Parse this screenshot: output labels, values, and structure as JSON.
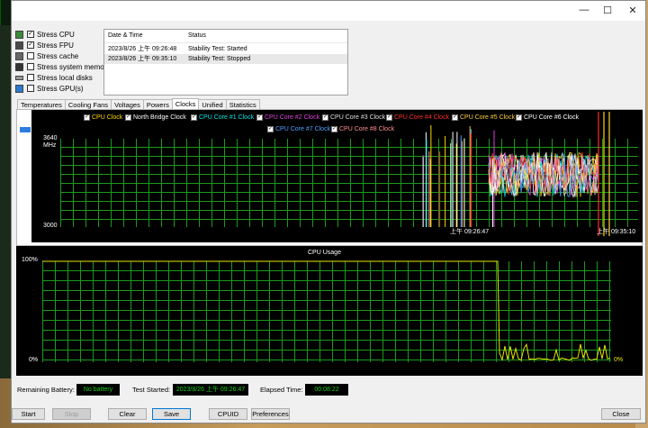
{
  "window": {
    "controls": {
      "minimize": "—",
      "maximize": "☐",
      "close": "✕"
    }
  },
  "stress_options": [
    {
      "label": "Stress CPU",
      "checked": true,
      "icon": "cpu-icon"
    },
    {
      "label": "Stress FPU",
      "checked": true,
      "icon": "fpu-icon"
    },
    {
      "label": "Stress cache",
      "checked": false,
      "icon": "cache-icon"
    },
    {
      "label": "Stress system memory",
      "checked": false,
      "icon": "memory-icon"
    },
    {
      "label": "Stress local disks",
      "checked": false,
      "icon": "disk-icon"
    },
    {
      "label": "Stress GPU(s)",
      "checked": false,
      "icon": "gpu-icon"
    }
  ],
  "log": {
    "headers": {
      "datetime": "Date & Time",
      "status": "Status"
    },
    "rows": [
      {
        "datetime": "2023/8/26 上午 09:26:48",
        "status": "Stability Test: Started"
      },
      {
        "datetime": "2023/8/26 上午 09:35:10",
        "status": "Stability Test: Stopped"
      }
    ]
  },
  "tabs": [
    "Temperatures",
    "Cooling Fans",
    "Voltages",
    "Powers",
    "Clocks",
    "Unified",
    "Statistics"
  ],
  "active_tab": "Clocks",
  "clock_chart": {
    "legend": [
      {
        "label": "CPU Clock",
        "color": "#ffd800"
      },
      {
        "label": "North Bridge Clock",
        "color": "#ffffff"
      },
      {
        "label": "CPU Core #1 Clock",
        "color": "#00e5e5"
      },
      {
        "label": "CPU Core #2 Clock",
        "color": "#e040e0"
      },
      {
        "label": "CPU Core #3 Clock",
        "color": "#e0e0e0"
      },
      {
        "label": "CPU Core #4 Clock",
        "color": "#ff3030"
      },
      {
        "label": "CPU Core #5 Clock",
        "color": "#ffd040"
      },
      {
        "label": "CPU Core #6 Clock",
        "color": "#ffffff"
      },
      {
        "label": "CPU Core #7 Clock",
        "color": "#4fa0ff"
      },
      {
        "label": "CPU Core #8 Clock",
        "color": "#ff9090"
      }
    ],
    "y_top": "3640",
    "y_unit": "MHz",
    "y_bottom": "3000",
    "time_start": "上午 09:26:47",
    "time_end": "上午 09:35:10"
  },
  "usage_chart": {
    "title": "CPU Usage",
    "y_top": "100%",
    "y_bottom": "0%",
    "current": "0%",
    "color": "#e6e600"
  },
  "status": {
    "battery_label": "Remaining Battery:",
    "battery_value": "No battery",
    "started_label": "Test Started:",
    "started_value": "2023/8/26 上午 09:26:47",
    "elapsed_label": "Elapsed Time:",
    "elapsed_value": "00:08:22"
  },
  "buttons": {
    "start": "Start",
    "stop": "Stop",
    "clear": "Clear",
    "save": "Save",
    "cpuid": "CPUID",
    "preferences": "Preferences",
    "close": "Close"
  }
}
